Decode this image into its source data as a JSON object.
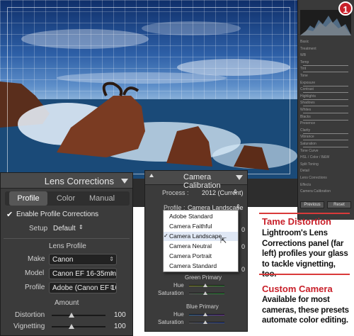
{
  "badge": "1",
  "lens_panel": {
    "title": "Lens Corrections",
    "tabs": [
      "Profile",
      "Color",
      "Manual"
    ],
    "enable_label": "Enable Profile Corrections",
    "setup_label": "Setup",
    "setup_value": "Default",
    "lens_profile_heading": "Lens Profile",
    "make_label": "Make",
    "make_value": "Canon",
    "model_label": "Model",
    "model_value": "Canon EF 16-35mm ...",
    "profile_label": "Profile",
    "profile_value": "Adobe (Canon EF 16...",
    "amount_heading": "Amount",
    "distortion_label": "Distortion",
    "distortion_value": "100",
    "vignetting_label": "Vignetting",
    "vignetting_value": "100"
  },
  "camera_panel": {
    "title": "Camera Calibration",
    "process_label": "Process :",
    "process_value": "2012 (Current)",
    "profile_label": "Profile :",
    "profile_value": "Camera Landscape",
    "menu_items": [
      "Adobe Standard",
      "Camera Faithful",
      "Camera Landscape",
      "Camera Neutral",
      "Camera Portrait",
      "Camera Standard"
    ],
    "selected_index": 2,
    "green_primary": "Green Primary",
    "blue_primary": "Blue Primary",
    "hue_label": "Hue",
    "saturation_label": "Saturation",
    "side_zero": "0"
  },
  "lightroom_right": {
    "rows": [
      "Basic",
      "Treatment",
      "WB",
      "Temp",
      "Tint",
      "Tone",
      "Exposure",
      "Contrast",
      "Highlights",
      "Shadows",
      "Whites",
      "Blacks",
      "Presence",
      "Clarity",
      "Vibrance",
      "Saturation",
      "Tone Curve",
      "HSL / Color / B&W",
      "Split Toning",
      "Detail",
      "Lens Corrections",
      "Effects",
      "Camera Calibration"
    ],
    "buttons": [
      "Previous",
      "Reset"
    ]
  },
  "sidebar": {
    "heading1": "Tame Distortion",
    "text1": "Lightroom's Lens Corrections panel (far left) profiles your glass to tackle vignetting, too.",
    "heading2": "Custom Camera",
    "text2": "Available for most cameras, these presets automate color editing."
  }
}
